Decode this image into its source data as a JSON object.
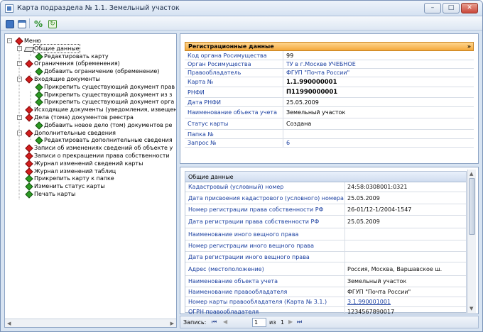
{
  "window": {
    "title": "Карта подраздела № 1.1. Земельный участок"
  },
  "tree": {
    "root": "Меню",
    "items": [
      {
        "label": "Общие данные",
        "level": 1,
        "icon": "book",
        "selected": true
      },
      {
        "label": "Редактировать карту",
        "level": 2,
        "icon": "green"
      },
      {
        "label": "Ограничения (обременения)",
        "level": 1,
        "icon": "red"
      },
      {
        "label": "Добавить ограничение (обременение)",
        "level": 2,
        "icon": "green"
      },
      {
        "label": "Входящие документы",
        "level": 1,
        "icon": "red"
      },
      {
        "label": "Прикрепить существующий документ прав",
        "level": 2,
        "icon": "green"
      },
      {
        "label": "Прикрепить существующий документ из з",
        "level": 2,
        "icon": "green"
      },
      {
        "label": "Прикрепить существующий документ орга",
        "level": 2,
        "icon": "green"
      },
      {
        "label": "Исходящие документы (уведомления, извещен",
        "level": 1,
        "icon": "red"
      },
      {
        "label": "Дела (тома) документов реестра",
        "level": 1,
        "icon": "red"
      },
      {
        "label": "Добавить новое дело (том) документов ре",
        "level": 2,
        "icon": "green"
      },
      {
        "label": "Дополнительные сведения",
        "level": 1,
        "icon": "red"
      },
      {
        "label": "Редактировать дополнительные сведения",
        "level": 2,
        "icon": "green"
      },
      {
        "label": "Записи об изменениях сведений об объекте у",
        "level": 1,
        "icon": "red"
      },
      {
        "label": "Записи о прекращении права собственности",
        "level": 1,
        "icon": "red"
      },
      {
        "label": "Журнал изменений сведений карты",
        "level": 1,
        "icon": "red"
      },
      {
        "label": "Журнал изменений таблиц",
        "level": 1,
        "icon": "red"
      },
      {
        "label": "Прикрепить карту  к папке",
        "level": 1,
        "icon": "green"
      },
      {
        "label": "Изменить статус карты",
        "level": 1,
        "icon": "green"
      },
      {
        "label": "Печать карты",
        "level": 1,
        "icon": "green"
      }
    ]
  },
  "registration": {
    "title": "Регистрационные данные",
    "rows": [
      {
        "k": "Код органа Росимущества",
        "v": "99",
        "style": ""
      },
      {
        "k": "Орган Росимущества",
        "v": "ТУ в г.Москве УЧЕБНОЕ",
        "style": "blue"
      },
      {
        "k": "Правообладатель",
        "v": "ФГУП \"Почта России\"",
        "style": "blue"
      },
      {
        "k": "Карта №",
        "v": "1.1.990000001",
        "style": "bold"
      },
      {
        "k": "РНФИ",
        "v": "П11990000001",
        "style": "bold"
      },
      {
        "k": "Дата РНФИ",
        "v": "25.05.2009",
        "style": ""
      },
      {
        "k": "Наименование объекта учета",
        "v": "Земельный участок",
        "style": ""
      },
      {
        "k": "Статус карты",
        "v": "Создана",
        "style": ""
      },
      {
        "k": "Папка №",
        "v": "",
        "style": ""
      },
      {
        "k": "Запрос №",
        "v": "6",
        "style": "blue"
      }
    ]
  },
  "general": {
    "title": "Общие данные",
    "rows": [
      {
        "k": "Кадастровый (условный) номер",
        "v": "24:58:0308001:0321",
        "style": ""
      },
      {
        "k": "Дата присвоения кадастрового (условного) номера",
        "v": "25.05.2009",
        "style": ""
      },
      {
        "k": "Номер регистрации права собственности РФ",
        "v": "26-01/12-1/2004-1547",
        "style": ""
      },
      {
        "k": "Дата регистрации права собственности РФ",
        "v": "25.05.2009",
        "style": ""
      },
      {
        "k": "Наименование иного вещного права",
        "v": "",
        "style": ""
      },
      {
        "k": "Номер регистрации иного вещного права",
        "v": "",
        "style": ""
      },
      {
        "k": "Дата регистрации иного вещного права",
        "v": "",
        "style": ""
      },
      {
        "k": "Адрес (местоположение)",
        "v": "Россия, Москва, Варшавское ш.",
        "style": ""
      },
      {
        "k": "Наименование объекта учета",
        "v": "Земельный участок",
        "style": ""
      },
      {
        "k": "Наименование правообладателя",
        "v": "ФГУП \"Почта России\"",
        "style": ""
      },
      {
        "k": "Номер карты правообладателя (Карта № 3.1.)",
        "v": "3.1.990001001",
        "style": "link"
      },
      {
        "k": "ОГРН правообладателя",
        "v": "1234567890017",
        "style": ""
      }
    ]
  },
  "pager": {
    "label": "Запись:",
    "current": "1",
    "of_label": "из",
    "total": "1"
  }
}
